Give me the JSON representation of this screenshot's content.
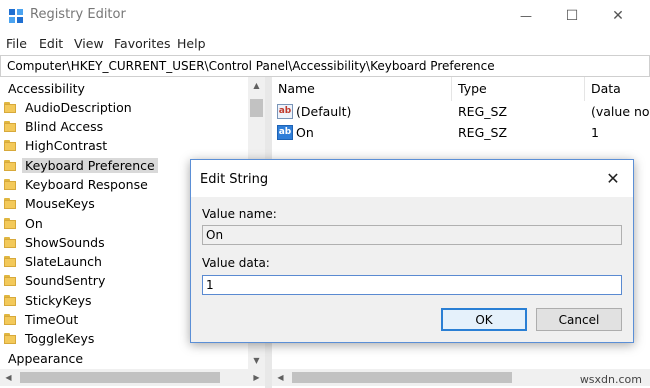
{
  "window": {
    "title": "Registry Editor",
    "minimize": "—",
    "maximize": "☐",
    "close": "✕"
  },
  "menu": [
    "File",
    "Edit",
    "View",
    "Favorites",
    "Help"
  ],
  "address": "Computer\\HKEY_CURRENT_USER\\Control Panel\\Accessibility\\Keyboard Preference",
  "tree": {
    "top": "Accessibility",
    "items": [
      "AudioDescription",
      "Blind Access",
      "HighContrast",
      "Keyboard Preference",
      "Keyboard Response",
      "MouseKeys",
      "On",
      "ShowSounds",
      "SlateLaunch",
      "SoundSentry",
      "StickyKeys",
      "TimeOut",
      "ToggleKeys"
    ],
    "selected": "Keyboard Preference",
    "bottom": "Appearance"
  },
  "list": {
    "columns": [
      "Name",
      "Type",
      "Data"
    ],
    "rows": [
      {
        "name": "(Default)",
        "type": "REG_SZ",
        "data": "(value not",
        "icon": "string-value-icon"
      },
      {
        "name": "On",
        "type": "REG_SZ",
        "data": "1",
        "icon": "string-value-icon"
      }
    ],
    "icon_text": "ab"
  },
  "dialog": {
    "title": "Edit String",
    "value_name_label": "Value name:",
    "value_name": "On",
    "value_data_label": "Value data:",
    "value_data": "1",
    "ok": "OK",
    "cancel": "Cancel"
  },
  "watermark": "wsxdn.com",
  "colors": {
    "accent": "#2a7fd4",
    "folder": "#f3c95a",
    "selection": "#d9d9d9"
  }
}
